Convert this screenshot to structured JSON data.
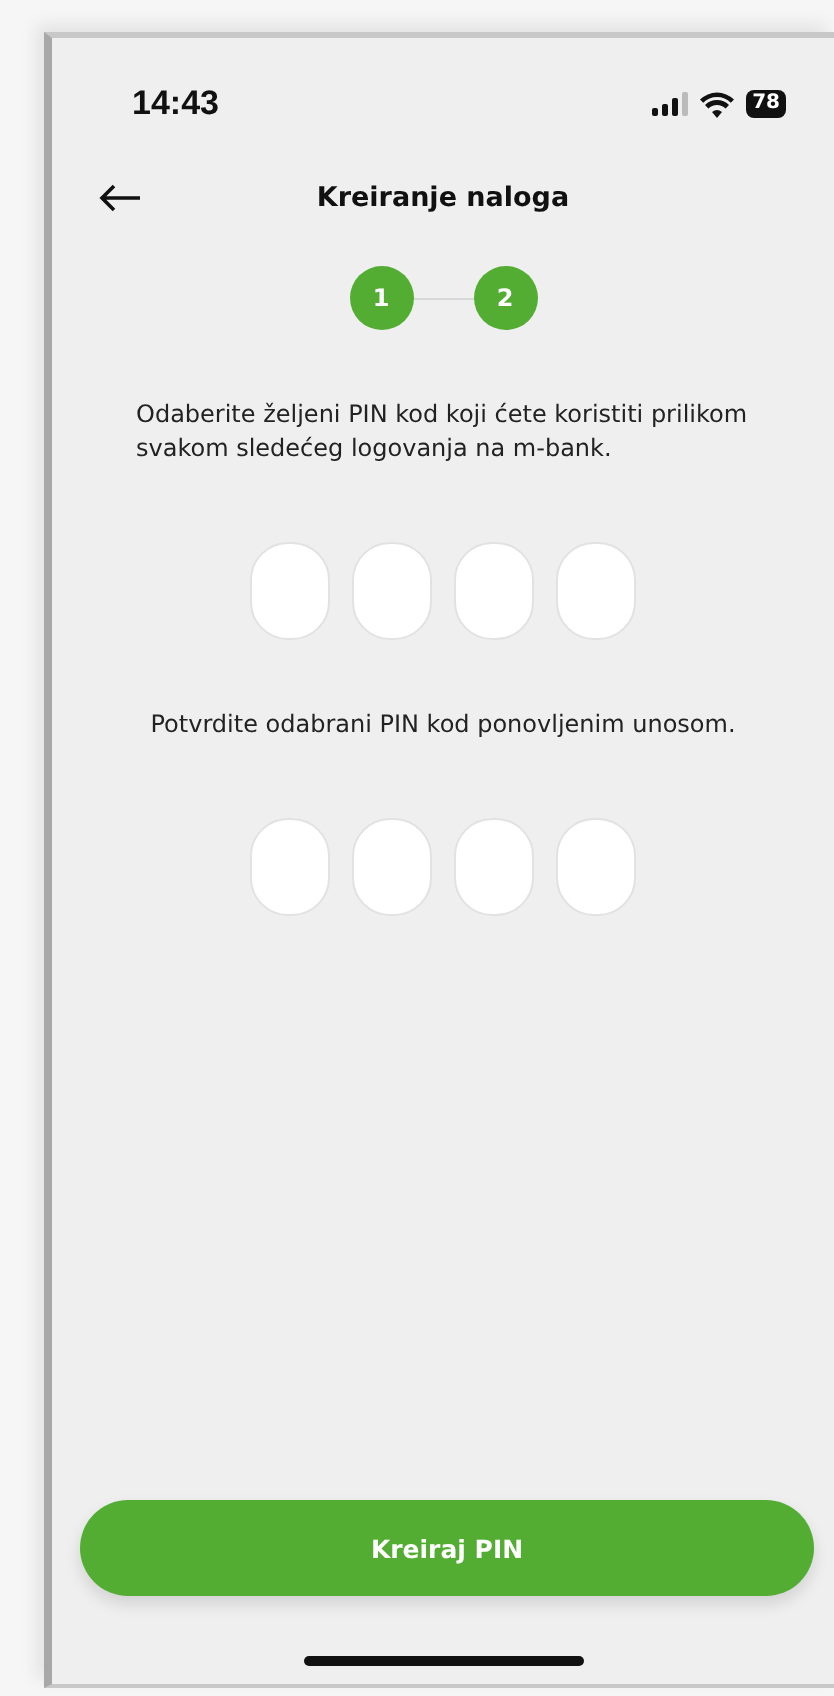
{
  "status_bar": {
    "time": "14:43",
    "battery": "78"
  },
  "header": {
    "title": "Kreiranje naloga"
  },
  "steps": [
    {
      "label": "1",
      "active": true
    },
    {
      "label": "2",
      "active": true
    }
  ],
  "pin_groups": [
    {
      "instruction": "Odaberite željeni PIN kod koji ćete koristiti prilikom svakom sledećeg logovanja na m-bank.",
      "digits": [
        {
          "filled": false
        },
        {
          "filled": false
        },
        {
          "filled": false
        },
        {
          "filled": false
        }
      ]
    },
    {
      "instruction": "Potvrdite odabrani PIN kod ponovljenim unosom.",
      "digits": [
        {
          "filled": false
        },
        {
          "filled": false
        },
        {
          "filled": false
        },
        {
          "filled": false
        }
      ]
    }
  ],
  "primary_button": {
    "label": "Kreiraj PIN"
  }
}
